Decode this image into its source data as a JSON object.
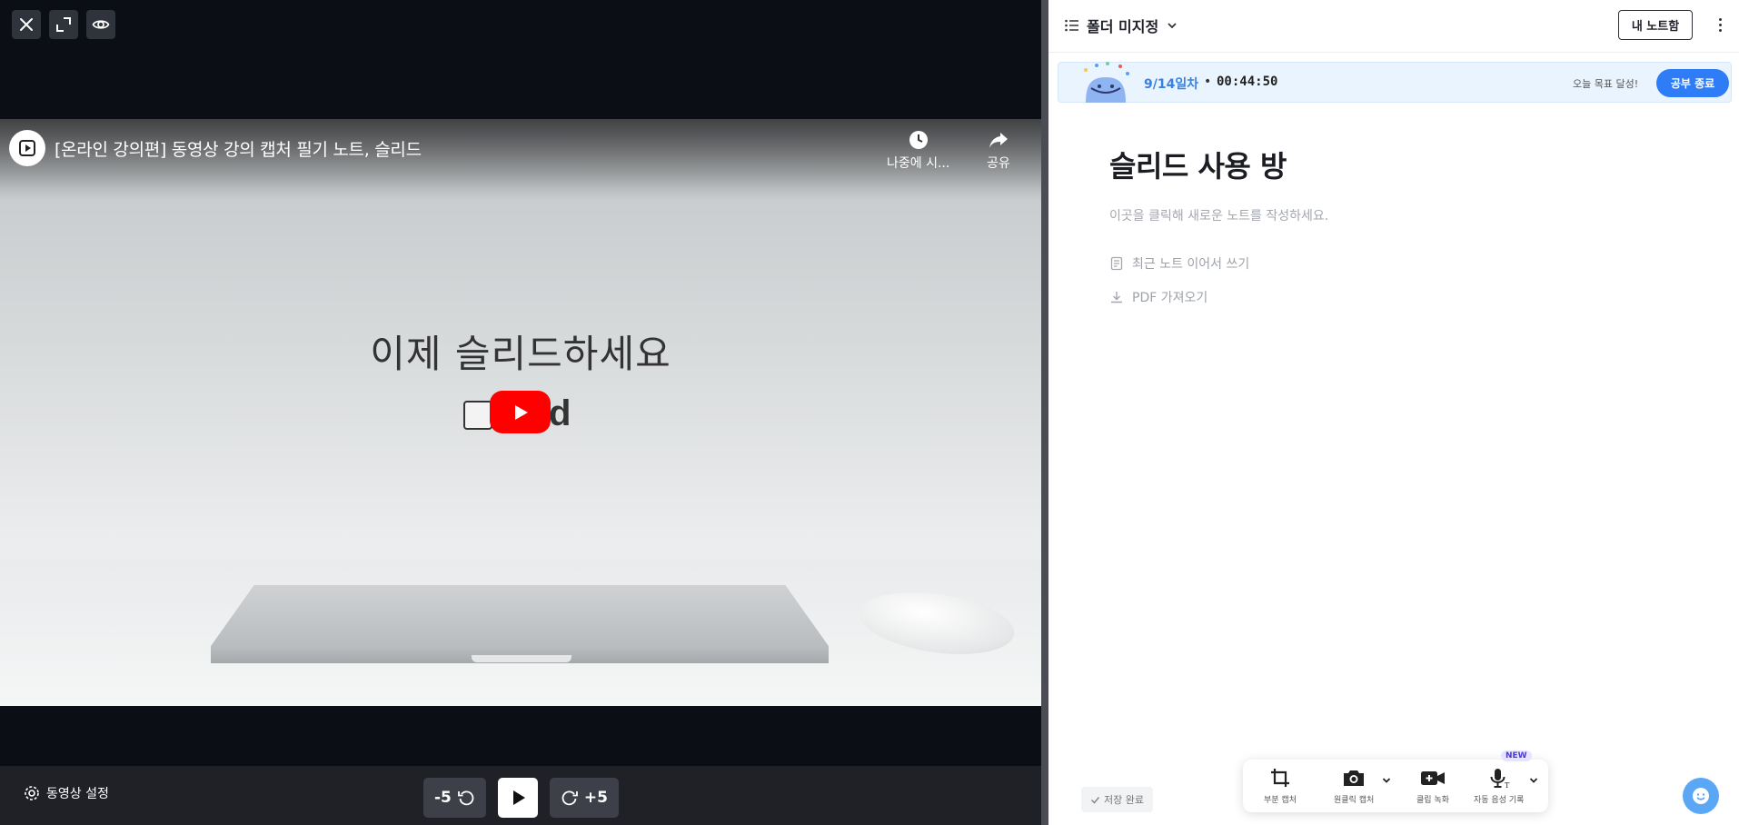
{
  "player": {
    "top_controls": [
      {
        "icon": "close-icon"
      },
      {
        "icon": "expand-icon"
      },
      {
        "icon": "eye-icon"
      }
    ],
    "video": {
      "title": "[온라인 강의편] 동영상 강의 캡처 필기 노트, 슬리드",
      "watch_later_label": "나중에 시...",
      "share_label": "공유",
      "slide_heading": "이제 슬리드하세요",
      "logo_letter": "d"
    },
    "bottom": {
      "settings_label": "동영상 설정",
      "rewind_label": "-5",
      "forward_label": "+5"
    }
  },
  "notes": {
    "folder_label": "폴더 미지정",
    "my_notes_label": "내 노트함",
    "study": {
      "day": "9/14일차",
      "separator": "•",
      "timer": "00:44:50",
      "goal_text": "오늘 목표 달성!",
      "end_label": "공부 종료"
    },
    "title": "슬리드 사용 방",
    "placeholder": "이곳을 클릭해 새로운 노트를 작성하세요.",
    "actions": {
      "recent": "최근 노트 이어서 쓰기",
      "pdf": "PDF 가져오기"
    },
    "save_status": "저장 완료",
    "toolbar": {
      "crop_label": "부분 캡처",
      "shot_label": "원클릭 캡처",
      "record_label": "클립 녹화",
      "voice_label": "자동 음성 기록",
      "new_badge": "NEW"
    }
  },
  "colors": {
    "accent": "#2e7cf6",
    "study_day": "#3b82e0",
    "youtube_red": "#ff0000",
    "player_bg": "#0b0e14"
  }
}
